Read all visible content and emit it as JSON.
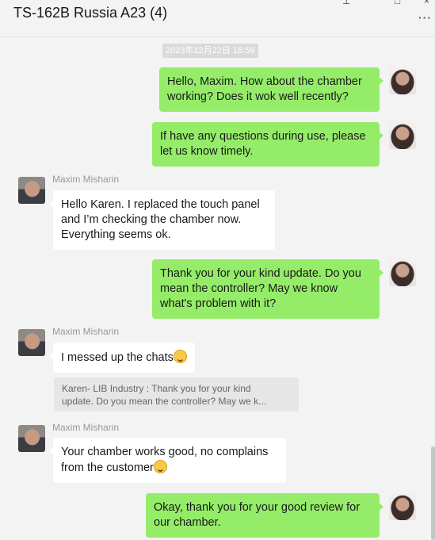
{
  "window": {
    "title": "TS-162B Russia A23 (4)",
    "more_icon": "more-dots-icon"
  },
  "chat": {
    "timestamp": "2023年12月22日 16:59",
    "messages": [
      {
        "sender": "me",
        "lines": [
          "Hello, Maxim. How about the chamber",
          "working?  Does it wok well recently?"
        ]
      },
      {
        "sender": "me",
        "lines": [
          "If have any questions during use, please",
          "let us know timely."
        ]
      },
      {
        "sender": "them",
        "name": "Maxim Misharin",
        "lines": [
          "Hello Karen. I replaced the touch panel",
          "and I’m checking the chamber now.",
          "Everything seems ok."
        ]
      },
      {
        "sender": "me",
        "lines": [
          "Thank you for your kind update. Do you",
          "mean the controller?  May we know",
          "what's problem with it?"
        ]
      },
      {
        "sender": "them",
        "name": "Maxim Misharin",
        "lines": [
          "I messed up the chats"
        ],
        "emoji": "grinning-emoji"
      },
      {
        "quote": {
          "lines": [
            "Karen- LIB Industry : Thank you for your kind",
            "update. Do you mean the controller?  May we k..."
          ]
        }
      },
      {
        "sender": "them",
        "name": "Maxim Misharin",
        "lines": [
          "Your chamber works good, no complains",
          "from the customer"
        ],
        "emoji": "smiling-emoji"
      },
      {
        "sender": "me",
        "lines": [
          "Okay, thank you for your good review for",
          "our chamber."
        ]
      }
    ]
  },
  "colors": {
    "my_bubble": "#95ec69",
    "their_bubble": "#ffffff",
    "background": "#f3f3f3",
    "name_text": "#999999"
  }
}
